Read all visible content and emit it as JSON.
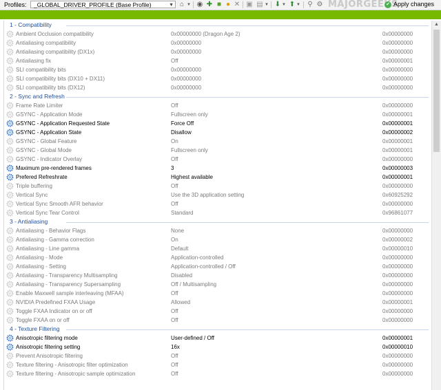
{
  "toolbar": {
    "profiles_label": "Profiles:",
    "profile_value": "_GLOBAL_DRIVER_PROFILE (Base Profile)",
    "apply_label": "Apply changes",
    "watermark": "MAJORGEEKS"
  },
  "sections": [
    {
      "title": "1 - Compatibility",
      "rows": [
        {
          "name": "Ambient Occlusion compatibility",
          "value": "0x00000000 (Dragon Age 2)",
          "hex": "0x00000000",
          "bold": false
        },
        {
          "name": "Antialiasing compatibility",
          "value": "0x00000000",
          "hex": "0x00000000",
          "bold": false
        },
        {
          "name": "Antialiasing compatibility (DX1x)",
          "value": "0x00000000",
          "hex": "0x00000000",
          "bold": false
        },
        {
          "name": "Antialiasing fix",
          "value": "Off",
          "hex": "0x00000001",
          "bold": false
        },
        {
          "name": "SLI compatibility bits",
          "value": "0x00000000",
          "hex": "0x00000000",
          "bold": false
        },
        {
          "name": "SLI compatibility bits (DX10 + DX11)",
          "value": "0x00000000",
          "hex": "0x00000000",
          "bold": false
        },
        {
          "name": "SLI compatibility bits (DX12)",
          "value": "0x00000000",
          "hex": "0x00000000",
          "bold": false
        }
      ]
    },
    {
      "title": "2 - Sync and Refresh",
      "rows": [
        {
          "name": "Frame Rate Limiter",
          "value": "Off",
          "hex": "0x00000000",
          "bold": false
        },
        {
          "name": "GSYNC - Application Mode",
          "value": "Fullscreen only",
          "hex": "0x00000001",
          "bold": false
        },
        {
          "name": "GSYNC - Application Requested State",
          "value": "Force Off",
          "hex": "0x00000001",
          "bold": true
        },
        {
          "name": "GSYNC - Application State",
          "value": "Disallow",
          "hex": "0x00000002",
          "bold": true
        },
        {
          "name": "GSYNC - Global Feature",
          "value": "On",
          "hex": "0x00000001",
          "bold": false
        },
        {
          "name": "GSYNC - Global Mode",
          "value": "Fullscreen only",
          "hex": "0x00000001",
          "bold": false
        },
        {
          "name": "GSYNC - Indicator Overlay",
          "value": "Off",
          "hex": "0x00000000",
          "bold": false
        },
        {
          "name": "Maximum pre-rendered frames",
          "value": "3",
          "hex": "0x00000003",
          "bold": true
        },
        {
          "name": "Prefered Refreshrate",
          "value": "Highest available",
          "hex": "0x00000001",
          "bold": true
        },
        {
          "name": "Triple buffering",
          "value": "Off",
          "hex": "0x00000000",
          "bold": false
        },
        {
          "name": "Vertical Sync",
          "value": "Use the 3D application setting",
          "hex": "0x60925292",
          "bold": false
        },
        {
          "name": "Vertical Sync Smooth AFR behavior",
          "value": "Off",
          "hex": "0x00000000",
          "bold": false
        },
        {
          "name": "Vertical Sync Tear Control",
          "value": "Standard",
          "hex": "0x96861077",
          "bold": false
        }
      ]
    },
    {
      "title": "3 - Antialiasing",
      "rows": [
        {
          "name": "Antialiasing - Behavior Flags",
          "value": "None",
          "hex": "0x00000000",
          "bold": false
        },
        {
          "name": "Antialiasing - Gamma correction",
          "value": "On",
          "hex": "0x00000002",
          "bold": false
        },
        {
          "name": "Antialiasing - Line gamma",
          "value": "Default",
          "hex": "0x00000010",
          "bold": false
        },
        {
          "name": "Antialiasing - Mode",
          "value": "Application-controlled",
          "hex": "0x00000000",
          "bold": false
        },
        {
          "name": "Antialiasing - Setting",
          "value": "Application-controlled / Off",
          "hex": "0x00000000",
          "bold": false
        },
        {
          "name": "Antialiasing - Transparency Multisampling",
          "value": "Disabled",
          "hex": "0x00000000",
          "bold": false
        },
        {
          "name": "Antialiasing - Transparency Supersampling",
          "value": "Off / Multisampling",
          "hex": "0x00000000",
          "bold": false
        },
        {
          "name": "Enable Maxwell sample interleaving (MFAA)",
          "value": "Off",
          "hex": "0x00000000",
          "bold": false
        },
        {
          "name": "NVIDIA Predefined FXAA Usage",
          "value": "Allowed",
          "hex": "0x00000001",
          "bold": false
        },
        {
          "name": "Toggle FXAA Indicator on or off",
          "value": "Off",
          "hex": "0x00000000",
          "bold": false
        },
        {
          "name": "Toggle FXAA on or off",
          "value": "Off",
          "hex": "0x00000000",
          "bold": false
        }
      ]
    },
    {
      "title": "4 - Texture Filtering",
      "rows": [
        {
          "name": "Anisotropic filtering mode",
          "value": "User-defined / Off",
          "hex": "0x00000001",
          "bold": true
        },
        {
          "name": "Anisotropic filtering setting",
          "value": "16x",
          "hex": "0x00000010",
          "bold": true
        },
        {
          "name": "Prevent Anisotropic filtering",
          "value": "Off",
          "hex": "0x00000000",
          "bold": false
        },
        {
          "name": "Texture filtering - Anisotropic filter optimization",
          "value": "Off",
          "hex": "0x00000000",
          "bold": false
        },
        {
          "name": "Texture filtering - Anisotropic sample optimization",
          "value": "Off",
          "hex": "0x00000000",
          "bold": false
        }
      ]
    }
  ],
  "colors": {
    "accent_green": "#76b900",
    "section_blue": "#1f4e9c",
    "default_text": "#7a7a7a",
    "modified_text": "#000000"
  },
  "icons": {
    "default_setting": "gear-icon-gray",
    "modified_setting": "gear-icon-blue"
  }
}
